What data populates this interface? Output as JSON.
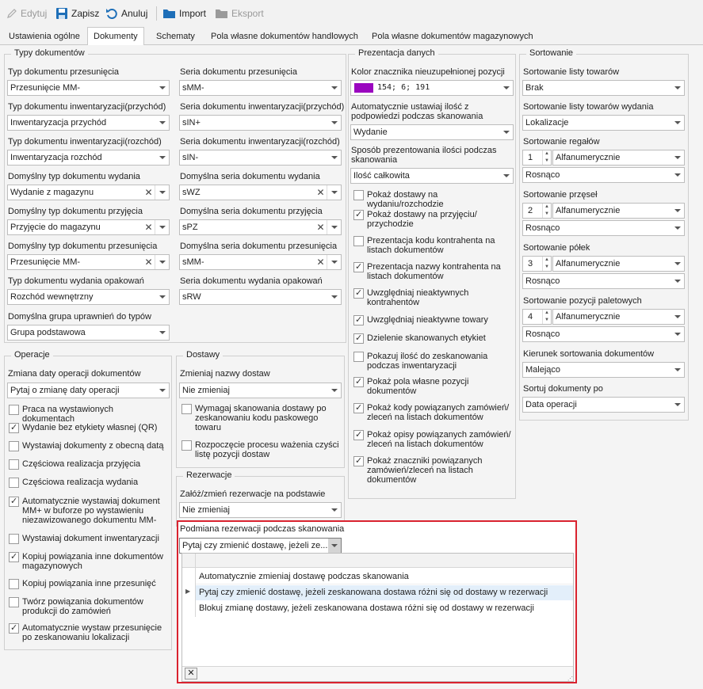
{
  "toolbar": {
    "edit": "Edytuj",
    "save": "Zapisz",
    "cancel": "Anuluj",
    "import": "Import",
    "export": "Eksport"
  },
  "tabs": [
    "Ustawienia ogólne",
    "Dokumenty",
    "Schematy",
    "Pola własne dokumentów handlowych",
    "Pola własne dokumentów magazynowych"
  ],
  "types": {
    "title": "Typy dokumentów",
    "left": [
      {
        "label": "Typ dokumentu przesunięcia",
        "value": "Przesunięcie MM-"
      },
      {
        "label": "Typ dokumentu inwentaryzacji(przychód)",
        "value": "Inwentaryzacja przychód"
      },
      {
        "label": "Typ dokumentu inwentaryzacji(rozchód)",
        "value": "Inwentaryzacja rozchód"
      },
      {
        "label": "Domyślny typ dokumentu wydania",
        "value": "Wydanie z magazynu"
      },
      {
        "label": "Domyślny typ dokumentu przyjęcia",
        "value": "Przyjęcie do magazynu"
      },
      {
        "label": "Domyślny typ dokumentu przesunięcia",
        "value": "Przesunięcie MM-"
      },
      {
        "label": "Typ dokumentu wydania opakowań",
        "value": "Rozchód wewnętrzny"
      },
      {
        "label": "Domyślna grupa uprawnień do typów",
        "value": "Grupa podstawowa"
      }
    ],
    "right": [
      {
        "label": "Seria dokumentu przesunięcia",
        "value": "sMM-"
      },
      {
        "label": "Seria dokumentu inwentaryzacji(przychód)",
        "value": "sIN+"
      },
      {
        "label": "Seria dokumentu inwentaryzacji(rozchód)",
        "value": "sIN-"
      },
      {
        "label": "Domyślna seria dokumentu wydania",
        "value": "sWZ"
      },
      {
        "label": "Domyślna seria dokumentu przyjęcia",
        "value": "sPZ"
      },
      {
        "label": "Domyślna seria dokumentu przesunięcia",
        "value": "sMM-"
      },
      {
        "label": "Seria dokumentu wydania opakowań",
        "value": "sRW"
      }
    ]
  },
  "operations": {
    "title": "Operacje",
    "date_label": "Zmiana daty operacji dokumentów",
    "date_value": "Pytaj o zmianę daty operacji",
    "checks": [
      {
        "label": "Praca na wystawionych dokumentach",
        "checked": false
      },
      {
        "label": "Wydanie bez etykiety własnej (QR)",
        "checked": true
      },
      {
        "label": "Wystawiaj dokumenty z obecną datą",
        "checked": false
      },
      {
        "label": "Częściowa realizacja przyjęcia",
        "checked": false
      },
      {
        "label": "Częściowa realizacja wydania",
        "checked": false
      },
      {
        "label": "Automatycznie wystawiaj dokument MM+ w buforze po wystawieniu niezawizowanego dokumentu MM-",
        "checked": true
      },
      {
        "label": "Wystawiaj dokument inwentaryzacji",
        "checked": false
      },
      {
        "label": "Kopiuj powiązania inne dokumentów magazynowych",
        "checked": true
      },
      {
        "label": "Kopiuj powiązania inne przesunięć",
        "checked": false
      },
      {
        "label": "Twórz powiązania dokumentów produkcji do zamówień",
        "checked": false
      },
      {
        "label": "Automatycznie wystaw przesunięcie po zeskanowaniu lokalizacji",
        "checked": true
      }
    ]
  },
  "deliveries": {
    "title": "Dostawy",
    "rename_label": "Zmieniaj nazwy dostaw",
    "rename_value": "Nie zmieniaj",
    "checks": [
      {
        "label": "Wymagaj skanowania dostawy po zeskanowaniu kodu paskowego towaru",
        "checked": false
      },
      {
        "label": "Rozpoczęcie procesu ważenia czyści listę pozycji dostaw",
        "checked": false
      }
    ]
  },
  "reservations": {
    "title": "Rezerwacje",
    "create_label": "Załóż/zmień rezerwacje na podstawie",
    "create_value": "Nie zmieniaj",
    "swap_label": "Podmiana rezerwacji podczas skanowania",
    "swap_value": "Pytaj czy zmienić dostawę, jeżeli ze...",
    "options": [
      "Automatycznie zmieniaj dostawę podczas skanowania",
      "Pytaj czy zmienić dostawę, jeżeli zeskanowana dostawa różni się od dostawy w rezerwacji",
      "Blokuj zmianę dostawy, jeżeli zeskanowana dostawa różni się od dostawy w rezerwacji"
    ],
    "selected_option": 1
  },
  "presentation": {
    "title": "Prezentacja danych",
    "color_label": "Kolor znacznika nieuzupełnionej pozycji",
    "color_value": "154; 6; 191",
    "color_hex": "#9a06bf",
    "auto_qty_label": "Automatycznie ustawiaj ilość z podpowiedzi podczas skanowania",
    "auto_qty_value": "Wydanie",
    "qty_mode_label": "Sposób prezentowania ilości podczas skanowania",
    "qty_mode_value": "Ilość całkowita",
    "checks": [
      {
        "label": "Pokaż dostawy na wydaniu/rozchodzie",
        "checked": false
      },
      {
        "label": "Pokaż dostawy na przyjęciu/ przychodzie",
        "checked": true
      },
      {
        "label": "Prezentacja kodu kontrahenta na listach dokumentów",
        "checked": false
      },
      {
        "label": "Prezentacja nazwy kontrahenta na listach dokumentów",
        "checked": true
      },
      {
        "label": "Uwzględniaj nieaktywnych kontrahentów",
        "checked": true
      },
      {
        "label": "Uwzględniaj nieaktywne towary",
        "checked": true
      },
      {
        "label": "Dzielenie skanowanych etykiet",
        "checked": true
      },
      {
        "label": "Pokazuj ilość do zeskanowania podczas inwentaryzacji",
        "checked": false
      },
      {
        "label": "Pokaż pola własne pozycji dokumentów",
        "checked": true
      },
      {
        "label": "Pokaż kody powiązanych zamówień/ zleceń na listach dokumentów",
        "checked": true
      },
      {
        "label": "Pokaż opisy powiązanych zamówień/ zleceń na listach dokumentów",
        "checked": true
      },
      {
        "label": "Pokaż znaczniki powiązanych zamówień/zleceń na listach dokumentów",
        "checked": true
      }
    ]
  },
  "sorting": {
    "title": "Sortowanie",
    "goods_label": "Sortowanie listy towarów",
    "goods_value": "Brak",
    "goods_issue_label": "Sortowanie listy towarów wydania",
    "goods_issue_value": "Lokalizacje",
    "levels": [
      {
        "label": "Sortowanie regałów",
        "num": "1",
        "mode": "Alfanumerycznie",
        "dir": "Rosnąco"
      },
      {
        "label": "Sortowanie przęseł",
        "num": "2",
        "mode": "Alfanumerycznie",
        "dir": "Rosnąco"
      },
      {
        "label": "Sortowanie półek",
        "num": "3",
        "mode": "Alfanumerycznie",
        "dir": "Rosnąco"
      },
      {
        "label": "Sortowanie pozycji paletowych",
        "num": "4",
        "mode": "Alfanumerycznie",
        "dir": "Rosnąco"
      }
    ],
    "doc_dir_label": "Kierunek sortowania dokumentów",
    "doc_dir_value": "Malejąco",
    "doc_sort_label": "Sortuj dokumenty po",
    "doc_sort_value": "Data operacji"
  }
}
